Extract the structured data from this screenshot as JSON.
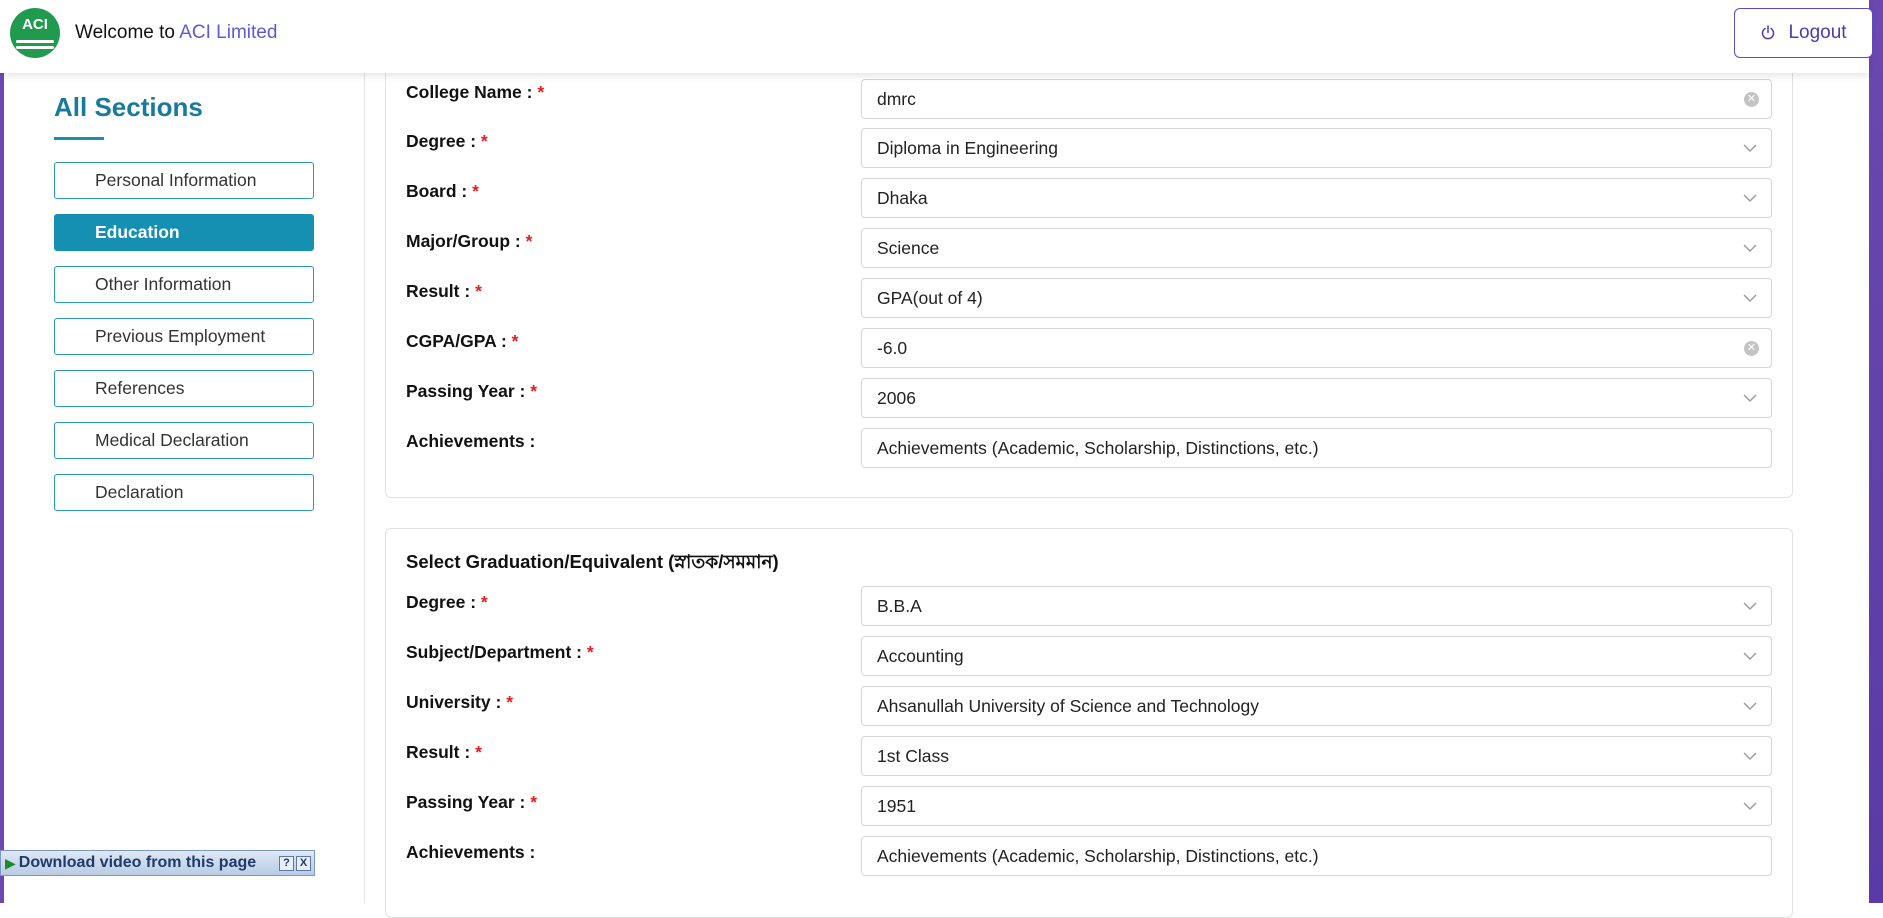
{
  "header": {
    "welcome_prefix": "Welcome to",
    "brand": "ACI Limited",
    "logo_text": "ACI",
    "logout_label": "Logout"
  },
  "sidebar": {
    "title": "All Sections",
    "items": [
      {
        "label": "Personal Information",
        "active": false
      },
      {
        "label": "Education",
        "active": true
      },
      {
        "label": "Other Information",
        "active": false
      },
      {
        "label": "Previous Employment",
        "active": false
      },
      {
        "label": "References",
        "active": false
      },
      {
        "label": "Medical Declaration",
        "active": false
      },
      {
        "label": "Declaration",
        "active": false
      }
    ]
  },
  "college_section": {
    "rows": [
      {
        "label": "College Name :",
        "required": "*",
        "value": "dmrc",
        "control": "clearable-input"
      },
      {
        "label": "Degree :",
        "required": "*",
        "value": "Diploma in Engineering",
        "control": "select"
      },
      {
        "label": "Board :",
        "required": "*",
        "value": "Dhaka",
        "control": "select"
      },
      {
        "label": "Major/Group :",
        "required": "*",
        "value": "Science",
        "control": "select"
      },
      {
        "label": "Result :",
        "required": "*",
        "value": "GPA(out of 4)",
        "control": "select"
      },
      {
        "label": "CGPA/GPA :",
        "required": "*",
        "value": "-6.0",
        "control": "clearable-input"
      },
      {
        "label": "Passing Year :",
        "required": "*",
        "value": "2006",
        "control": "select"
      },
      {
        "label": "Achievements :",
        "placeholder": "Achievements (Academic, Scholarship, Distinctions, etc.)",
        "control": "input"
      }
    ]
  },
  "graduation_section": {
    "heading": "Select Graduation/Equivalent (স্নাতক/সমমান)",
    "rows": [
      {
        "label": "Degree :",
        "required": "*",
        "value": "B.B.A",
        "control": "select"
      },
      {
        "label": "Subject/Department :",
        "required": "*",
        "value": "Accounting",
        "control": "select"
      },
      {
        "label": "University :",
        "required": "*",
        "value": "Ahsanullah University of Science and Technology",
        "control": "select"
      },
      {
        "label": "Result :",
        "required": "*",
        "value": "1st Class",
        "control": "select"
      },
      {
        "label": "Passing Year :",
        "required": "*",
        "value": "1951",
        "control": "select"
      },
      {
        "label": "Achievements :",
        "placeholder": "Achievements (Academic, Scholarship, Distinctions, etc.)",
        "control": "input"
      }
    ]
  },
  "download_bar": {
    "label": "Download video from this page",
    "help": "?",
    "close": "X"
  },
  "colors": {
    "accent": "#1590b2",
    "brand_link": "#5b5bd6",
    "required": "#e02020",
    "logo_green": "#1f9a4e",
    "page_edge": "#6c48b0"
  }
}
